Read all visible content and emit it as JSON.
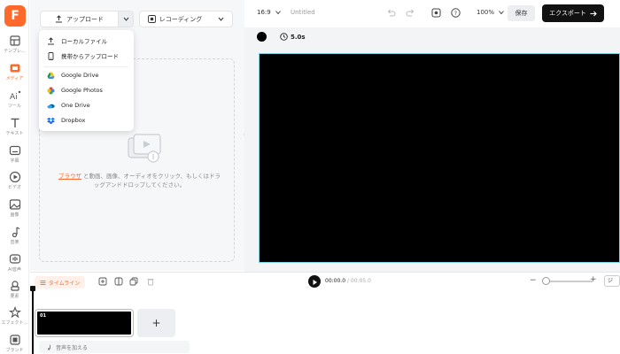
{
  "app": {
    "logo_letter": "F",
    "accent": "#ff6a2c"
  },
  "sidebar": {
    "items": [
      {
        "label": "テンプレ…",
        "icon": "template-icon"
      },
      {
        "label": "メディア",
        "icon": "media-folder-icon"
      },
      {
        "label": "ツール",
        "icon": "ai-tools-icon"
      },
      {
        "label": "テキスト",
        "icon": "text-icon"
      },
      {
        "label": "字幕",
        "icon": "subtitle-icon"
      },
      {
        "label": "ビデオ",
        "icon": "video-icon"
      },
      {
        "label": "画像",
        "icon": "image-icon"
      },
      {
        "label": "音楽",
        "icon": "music-icon"
      },
      {
        "label": "AI音声",
        "icon": "ai-voice-icon"
      },
      {
        "label": "要素",
        "icon": "elements-icon"
      },
      {
        "label": "エフェクト…",
        "icon": "effects-icon"
      },
      {
        "label": "ブランド",
        "icon": "brand-icon"
      }
    ]
  },
  "panel": {
    "upload_label": "アップロード",
    "record_label": "レコーディング",
    "drop_link": "ブラウザ",
    "drop_text": "と動画、画像、オーディオをクリック、もしくはドラッグアンドドロップしてください。"
  },
  "upload_menu": {
    "items": [
      {
        "label": "ローカルファイル",
        "icon": "upload-icon"
      },
      {
        "label": "携帯からアップロード",
        "icon": "phone-icon"
      },
      {
        "label": "Google Drive",
        "icon": "google-drive-icon"
      },
      {
        "label": "Google Photos",
        "icon": "google-photos-icon"
      },
      {
        "label": "One Drive",
        "icon": "onedrive-icon"
      },
      {
        "label": "Dropbox",
        "icon": "dropbox-icon"
      }
    ]
  },
  "topbar": {
    "aspect_ratio": "16:9",
    "project_title": "Untitled",
    "zoom": "100%",
    "save_label": "保存",
    "export_label": "エクスポート"
  },
  "preview": {
    "background_color": "#000000",
    "duration": "5.0s"
  },
  "timeline": {
    "mode_label": "タイムライン",
    "current_time": "00:00.0",
    "total_time": "/ 00:05.0",
    "fit_label": "ジ",
    "clip_number": "01",
    "add_clip_label": "+",
    "audio_label": "音声を加える"
  }
}
